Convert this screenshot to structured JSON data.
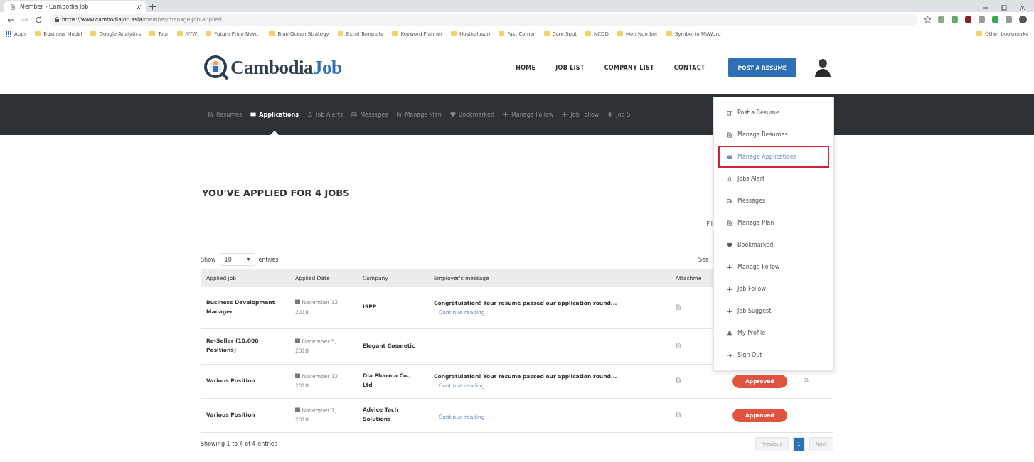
{
  "browser": {
    "tab_title": "Member - Cambodia Job",
    "url_host": "https://www.cambodiajob.asia",
    "url_path": "/member/manage-job-applied",
    "bookmarks": [
      "Apps",
      "Business Model",
      "Google Analytics",
      "Tour",
      "NYW",
      "Future Price New...",
      "Blue Ocean Strategy",
      "Excel Template",
      "Keyword Planner",
      "Hostkalusun",
      "Fast Comer",
      "Core Spot",
      "NCDD",
      "Men Number",
      "Symbol in MsWord"
    ],
    "other_bookmarks": "Other bookmarks"
  },
  "header": {
    "logo_main": "Cambodia",
    "logo_accent": "Job",
    "nav": [
      "HOME",
      "JOB LIST",
      "COMPANY LIST",
      "CONTACT"
    ],
    "post_button": "POST A RESUME"
  },
  "member_nav": [
    {
      "label": "Resumes",
      "kind": "doc",
      "selected": false
    },
    {
      "label": "Applications",
      "kind": "card",
      "selected": true
    },
    {
      "label": "Job Alerts",
      "kind": "bell",
      "selected": false
    },
    {
      "label": "Messages",
      "kind": "chat",
      "selected": false
    },
    {
      "label": "Manage Plan",
      "kind": "doc",
      "selected": false
    },
    {
      "label": "Bookmarked",
      "kind": "heart",
      "selected": false
    },
    {
      "label": "Manage Follow",
      "kind": "plus",
      "selected": false
    },
    {
      "label": "Job Follow",
      "kind": "plus",
      "selected": false
    },
    {
      "label": "Job S",
      "kind": "plus",
      "selected": false
    }
  ],
  "dropdown": [
    {
      "label": "Post a Resume",
      "kind": "edit",
      "selected": false
    },
    {
      "label": "Manage Resumes",
      "kind": "doc",
      "selected": false
    },
    {
      "label": "Manage Applications",
      "kind": "card",
      "selected": true
    },
    {
      "label": "Jobs Alert",
      "kind": "bell",
      "selected": false
    },
    {
      "label": "Messages",
      "kind": "chat",
      "selected": false
    },
    {
      "label": "Manage Plan",
      "kind": "doc",
      "selected": false
    },
    {
      "label": "Bookmarked",
      "kind": "heart",
      "selected": false
    },
    {
      "label": "Manage Follow",
      "kind": "plus",
      "selected": false
    },
    {
      "label": "Job Follow",
      "kind": "plus",
      "selected": false
    },
    {
      "label": "Job Suggest",
      "kind": "plus",
      "selected": false
    },
    {
      "label": "My Profile",
      "kind": "user",
      "selected": false
    },
    {
      "label": "Sign Out",
      "kind": "signout",
      "selected": false
    }
  ],
  "page": {
    "title": "YOU'VE APPLIED FOR 4 JOBS",
    "filter_label": "Fil",
    "show_label": "Show",
    "entries_value": "10",
    "entries_label": "entries",
    "search_label": "Sea",
    "columns": [
      "Applied job",
      "Applied Date",
      "Company",
      "Employer's message",
      "Attachme"
    ],
    "rows": [
      {
        "job": "Business Development Manager",
        "date": "November 12, 2018",
        "company": "ISPP",
        "message": "Congratulation! Your resume passed our application round...",
        "link": "Continue reading",
        "chat": false
      },
      {
        "job": "Re-Seller (10,000 Positions)",
        "date": "December 5, 2018",
        "company": "Elegant Cosmetic",
        "chat": false
      },
      {
        "job": "Various Position",
        "date": "November 12, 2018",
        "company": "Dia Pharma Co., Ltd",
        "message": "Congratulation! Your resume passed our application round...",
        "link": "Continue reading",
        "status": "Approved",
        "chat": true
      },
      {
        "job": "Various Position",
        "date": "November 7, 2018",
        "company": "Advice Tech Solutions",
        "link": "Continue reading",
        "status": "Approved",
        "chat": false
      }
    ],
    "footer": "Showing 1 to 4 of 4 entries",
    "pagination": [
      {
        "label": "Previous",
        "selected": false
      },
      {
        "label": "1",
        "selected": true
      },
      {
        "label": "Next",
        "selected": false
      }
    ]
  }
}
